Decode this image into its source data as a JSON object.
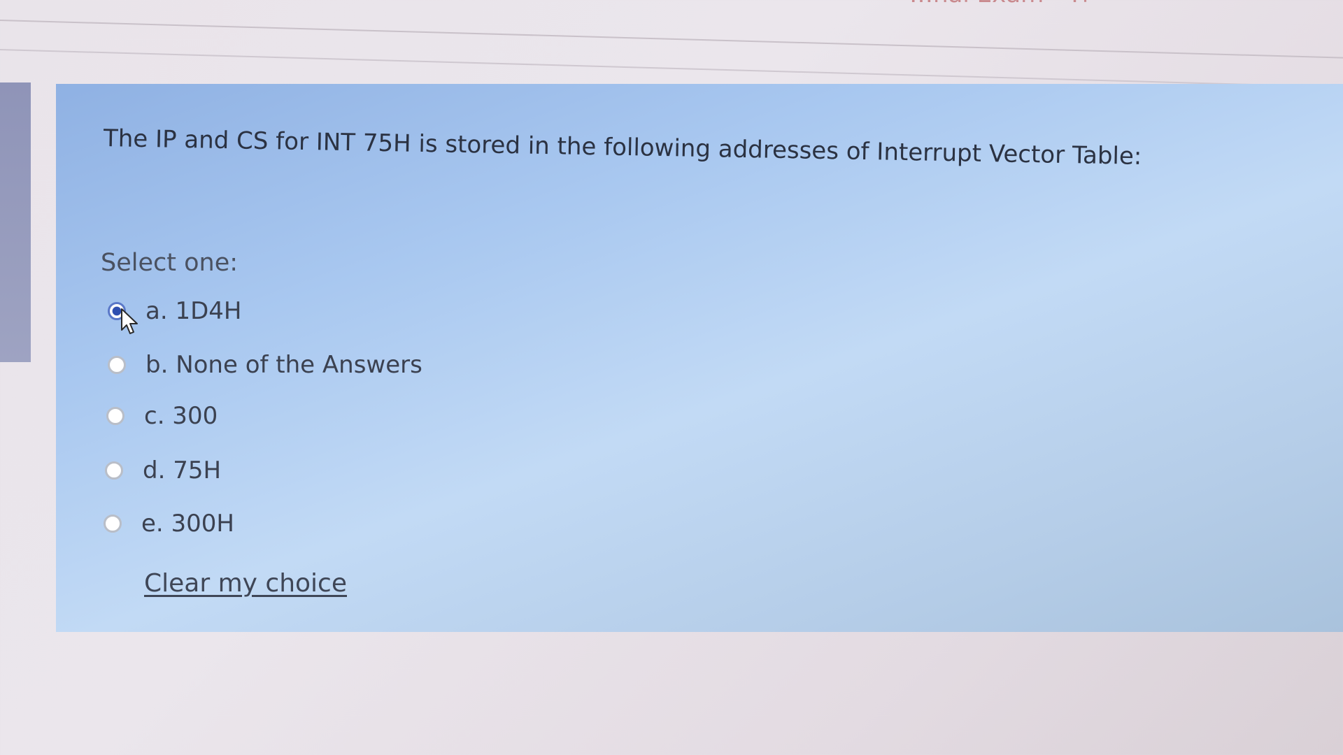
{
  "header": {
    "fragment_text": "…nal Exam - Theory"
  },
  "question": {
    "text": "The IP and CS for INT 75H is stored in the following addresses of Interrupt Vector Table:",
    "prompt": "Select one:",
    "options": [
      {
        "label": "a. 1D4H",
        "selected": true
      },
      {
        "label": "b. None of the Answers",
        "selected": false
      },
      {
        "label": "c. 300",
        "selected": false
      },
      {
        "label": "d. 75H",
        "selected": false
      },
      {
        "label": "e. 300H",
        "selected": false
      }
    ],
    "clear_label": "Clear my choice"
  },
  "colors": {
    "panel": "#b5cdee",
    "radio_selected": "#2f4fb0",
    "text": "#2b3242"
  }
}
